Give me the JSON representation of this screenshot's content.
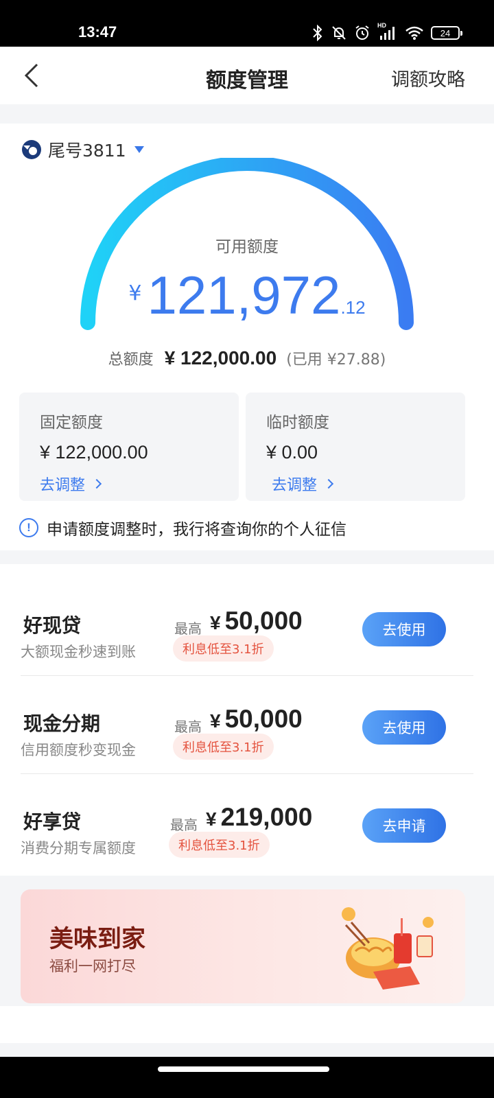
{
  "status": {
    "time": "13:47",
    "battery": "24",
    "hd": "HD"
  },
  "nav": {
    "title": "额度管理",
    "right_link": "调额攻略"
  },
  "card": {
    "tail": "尾号3811"
  },
  "available": {
    "label": "可用额度",
    "currency": "¥",
    "integer": "121,972",
    "decimal": ".12",
    "fraction_of_total": 0.9998
  },
  "total": {
    "label": "总额度",
    "value": "¥ 122,000.00",
    "used": "(已用 ¥27.88)"
  },
  "fixed": {
    "title": "固定额度",
    "value": "¥ 122,000.00",
    "action": "去调整"
  },
  "temp": {
    "title": "临时额度",
    "value": "¥ 0.00",
    "action": "去调整"
  },
  "notice": {
    "icon": "!",
    "text": "申请额度调整时，我行将查询你的个人征信"
  },
  "loans": [
    {
      "name": "好现贷",
      "desc": "大额现金秒速到账",
      "max_label": "最高",
      "currency": "¥",
      "max": "50,000",
      "rate": "利息低至3.1折",
      "button": "去使用"
    },
    {
      "name": "现金分期",
      "desc": "信用额度秒变现金",
      "max_label": "最高",
      "currency": "¥",
      "max": "50,000",
      "rate": "利息低至3.1折",
      "button": "去使用"
    },
    {
      "name": "好享贷",
      "desc": "消费分期专属额度",
      "max_label": "最高",
      "currency": "¥",
      "max": "219,000",
      "rate": "利息低至3.1折",
      "button": "去申请"
    }
  ],
  "banner": {
    "title": "美味到家",
    "subtitle": "福利一网打尽"
  },
  "colors": {
    "accent": "#3d7bee",
    "gauge_start": "#1fd2f7",
    "gauge_end": "#3a7cf2",
    "rate_text": "#e4533f"
  }
}
